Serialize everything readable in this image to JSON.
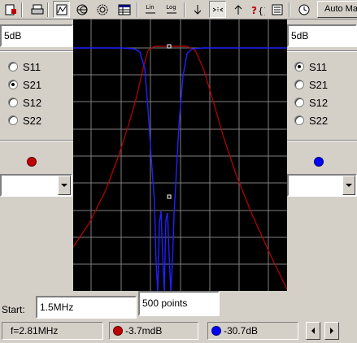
{
  "toolbar": {
    "lin_label": "Lin",
    "log_label": "Log",
    "auto_label": "Auto Ma"
  },
  "left_panel": {
    "scale_value": "5dB",
    "params": [
      "S11",
      "S21",
      "S12",
      "S22"
    ],
    "selected": "S21",
    "trace_color": "#c00000"
  },
  "right_panel": {
    "scale_value": "5dB",
    "params": [
      "S11",
      "S21",
      "S12",
      "S22"
    ],
    "selected": "S11",
    "trace_color": "#0000ff"
  },
  "sweep": {
    "start_label": "Start:",
    "start_value": "1.5MHz",
    "points_value": "500 points"
  },
  "status": {
    "frequency": "f=2.81MHz",
    "marker1_value": "-3.7mdB",
    "marker2_value": "-30.7dB"
  },
  "colors": {
    "trace_red": "#c00000",
    "trace_blue": "#2020ff",
    "grid": "#ffffff",
    "plot_bg": "#000000"
  }
}
